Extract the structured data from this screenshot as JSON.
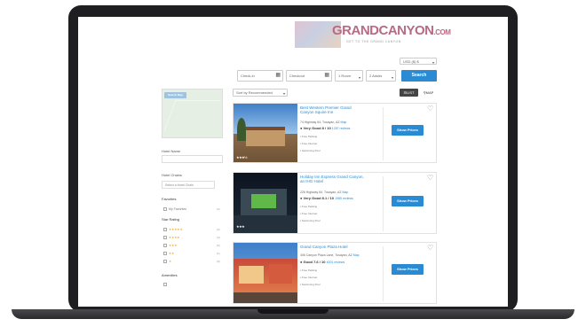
{
  "header": {
    "logo_text": "GRANDCANYON",
    "logo_suffix": ".COM",
    "tagline": "GET TO THE GRAND CANYON"
  },
  "toolbar": {
    "currency": "USD ($) $",
    "checkin_placeholder": "Check-in",
    "checkout_placeholder": "Checkout",
    "rooms": "1 Room",
    "adults": "2 Adults",
    "search_label": "Search",
    "sort_label": "Sort by Recommended",
    "list_label": "LIST",
    "map_label": "MAP"
  },
  "sidebar": {
    "map_button": "Search Map",
    "hotel_name_label": "Hotel Name",
    "hotel_chain_label": "Hotel Chains",
    "hotel_chain_select": "Select a Hotel Chain",
    "favorites_label": "Favorites",
    "favorites_item": "My Favorites",
    "favorites_count": "(0)",
    "star_rating_label": "Star Rating",
    "stars": [
      {
        "stars": "★★★★★",
        "count": "(0)"
      },
      {
        "stars": "★★★★",
        "count": "(4)"
      },
      {
        "stars": "★★★",
        "count": "(6)"
      },
      {
        "stars": "★★",
        "count": "(1)"
      },
      {
        "stars": "★",
        "count": "(0)"
      }
    ],
    "amenities_label": "Amenities"
  },
  "hotels": [
    {
      "name": "Best Western Premier Grand Canyon Squire Inn",
      "address": "74 Highway 64, Tusayan, AZ",
      "map_link": "Map",
      "rating": "Very Good 8 / 10",
      "reviews": "1257 reviews",
      "amenities": [
        "Free Parking",
        "Free Internet",
        "Swimming Pool"
      ],
      "stars": "★★★½",
      "button": "Show Prices"
    },
    {
      "name": "Holiday Inn Express Grand Canyon, an IHG Hotel",
      "address": "226 Highway 64, Tusayan, AZ",
      "map_link": "Map",
      "rating": "Very Good 8.1 / 10",
      "reviews": "1985 reviews",
      "amenities": [
        "Free Parking",
        "Free Internet",
        "Swimming Pool"
      ],
      "stars": "★★★",
      "button": "Show Prices"
    },
    {
      "name": "Grand Canyon Plaza Hotel",
      "address": "406 Canyon Plaza Lane, Tusayan, AZ",
      "map_link": "Map",
      "rating": "Good 7.6 / 10",
      "reviews": "4001 reviews",
      "amenities": [
        "Free Parking",
        "Free Internet",
        "Swimming Pool"
      ],
      "stars": "★★★",
      "button": "Show Prices"
    }
  ],
  "colors": {
    "accent": "#2a8bd3",
    "logo": "#b86a86",
    "bezel": "#1f1f21"
  }
}
